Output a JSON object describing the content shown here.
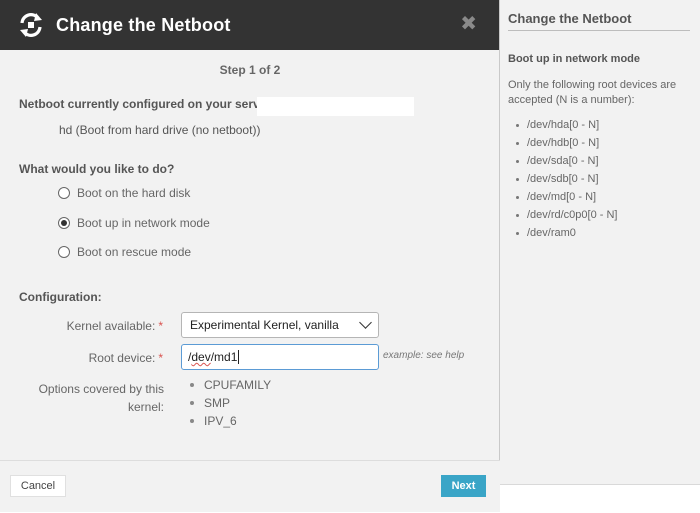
{
  "modal": {
    "title": "Change the Netboot",
    "close_symbol": "✖",
    "step": "Step 1 of 2",
    "current_label": "Netboot currently configured on your server",
    "current_value": "hd (Boot from hard drive (no netboot))",
    "question": "What would you like to do?",
    "options": [
      {
        "label": "Boot on the hard disk",
        "checked": false
      },
      {
        "label": "Boot up in network mode",
        "checked": true
      },
      {
        "label": "Boot on rescue mode",
        "checked": false
      }
    ],
    "configuration_label": "Configuration:",
    "kernel_label": "Kernel available:",
    "kernel_value": "Experimental Kernel, vanilla",
    "root_label": "Root device:",
    "root_value_prefix": "/",
    "root_value_squiggle": "dev",
    "root_value_suffix": "/md1",
    "root_hint": "example: see help",
    "options_covered_label": "Options covered by this kernel:",
    "kernel_options": [
      "CPUFAMILY",
      "SMP",
      "IPV_6"
    ],
    "required_mark": "*",
    "cancel_label": "Cancel",
    "next_label": "Next"
  },
  "help": {
    "title": "Change the Netboot",
    "subtitle": "Boot up in network mode",
    "text": "Only the following root devices are accepted (N is a number):",
    "devices": [
      "/dev/hda[0 - N]",
      "/dev/hdb[0 - N]",
      "/dev/sda[0 - N]",
      "/dev/sdb[0 - N]",
      "/dev/md[0 - N]",
      "/dev/rd/c0p0[0 - N]",
      "/dev/ram0"
    ]
  },
  "colors": {
    "header_bg": "#333333",
    "accent": "#3aa5c7",
    "required": "#d9534f"
  },
  "icons": {
    "header": "refresh-cycle-icon",
    "close": "close-icon",
    "dropdown": "chevron-down-icon"
  }
}
